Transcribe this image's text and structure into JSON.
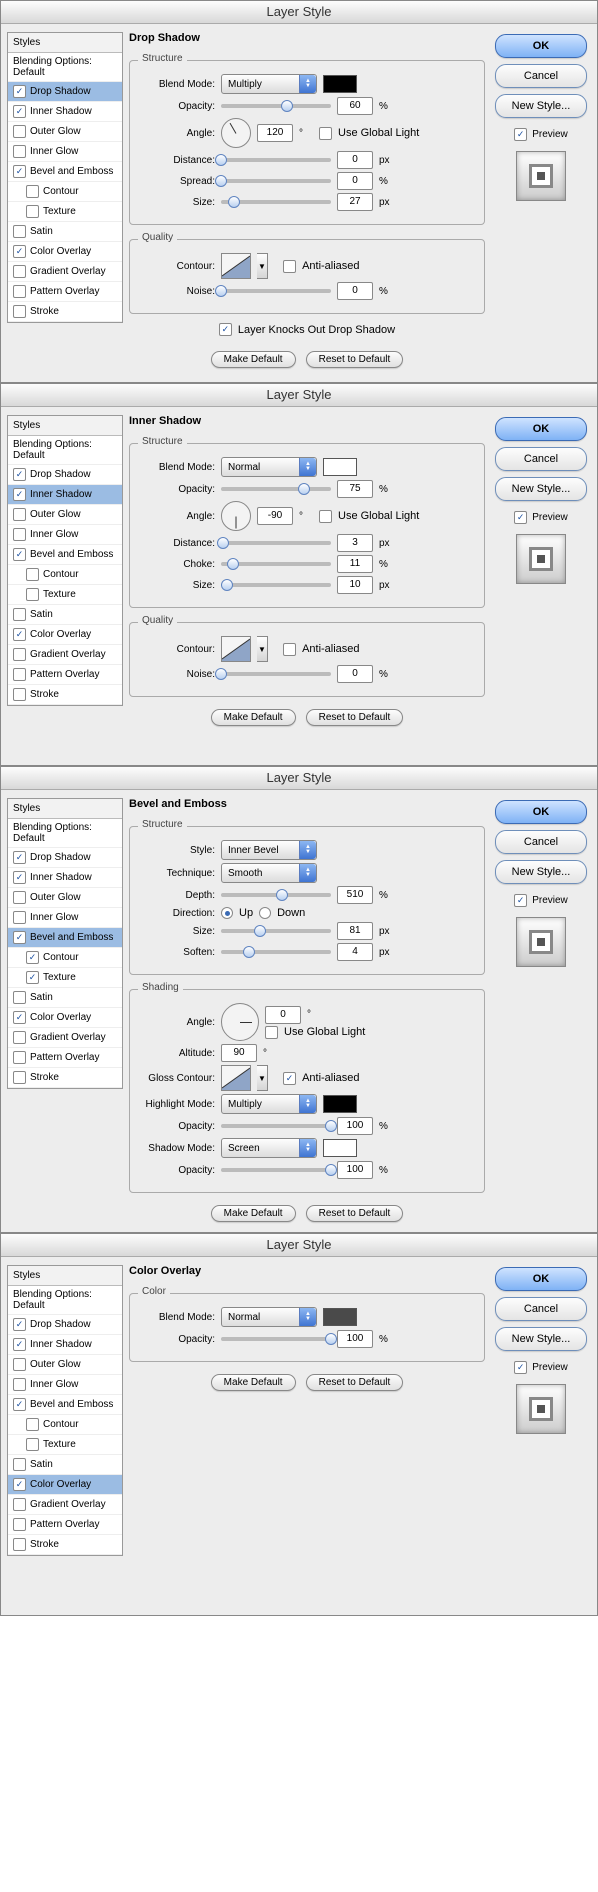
{
  "windowTitle": "Layer Style",
  "buttons": {
    "ok": "OK",
    "cancel": "Cancel",
    "newStyle": "New Style...",
    "preview": "Preview",
    "makeDefault": "Make Default",
    "resetDefault": "Reset to Default"
  },
  "sidebar": {
    "header": "Styles",
    "blendingDefault": "Blending Options: Default",
    "items": [
      {
        "label": "Drop Shadow",
        "indent": false
      },
      {
        "label": "Inner Shadow",
        "indent": false
      },
      {
        "label": "Outer Glow",
        "indent": false
      },
      {
        "label": "Inner Glow",
        "indent": false
      },
      {
        "label": "Bevel and Emboss",
        "indent": false
      },
      {
        "label": "Contour",
        "indent": true
      },
      {
        "label": "Texture",
        "indent": true
      },
      {
        "label": "Satin",
        "indent": false
      },
      {
        "label": "Color Overlay",
        "indent": false
      },
      {
        "label": "Gradient Overlay",
        "indent": false
      },
      {
        "label": "Pattern Overlay",
        "indent": false
      },
      {
        "label": "Stroke",
        "indent": false
      }
    ]
  },
  "labels": {
    "structure": "Structure",
    "quality": "Quality",
    "shading": "Shading",
    "color": "Color",
    "blendMode": "Blend Mode:",
    "opacity": "Opacity:",
    "angle": "Angle:",
    "useGlobal": "Use Global Light",
    "distance": "Distance:",
    "spread": "Spread:",
    "size": "Size:",
    "choke": "Choke:",
    "contour": "Contour:",
    "antialiased": "Anti-aliased",
    "noise": "Noise:",
    "knocksOut": "Layer Knocks Out Drop Shadow",
    "style": "Style:",
    "technique": "Technique:",
    "depth": "Depth:",
    "direction": "Direction:",
    "up": "Up",
    "down": "Down",
    "soften": "Soften:",
    "altitude": "Altitude:",
    "gloss": "Gloss Contour:",
    "highlight": "Highlight Mode:",
    "shadow": "Shadow Mode:",
    "px": "px",
    "pct": "%",
    "deg": "°"
  },
  "panels": [
    {
      "title": "Drop Shadow",
      "selected": "Drop Shadow",
      "checked": {
        "Drop Shadow": true,
        "Inner Shadow": true,
        "Bevel and Emboss": true,
        "Color Overlay": true
      },
      "fields": {
        "blendMode": "Multiply",
        "swatch": "#000000",
        "opacity": "60",
        "angle": "120",
        "useGlobal": false,
        "distance": "0",
        "spread": "0",
        "size": "27",
        "antialiased": false,
        "noise": "0",
        "knocksOut": true
      }
    },
    {
      "title": "Inner Shadow",
      "selected": "Inner Shadow",
      "checked": {
        "Drop Shadow": true,
        "Inner Shadow": true,
        "Bevel and Emboss": true,
        "Color Overlay": true
      },
      "fields": {
        "blendMode": "Normal",
        "swatch": "#ffffff",
        "opacity": "75",
        "angle": "-90",
        "useGlobal": false,
        "distance": "3",
        "choke": "11",
        "size": "10",
        "antialiased": false,
        "noise": "0"
      }
    },
    {
      "title": "Bevel and Emboss",
      "selected": "Bevel and Emboss",
      "checked": {
        "Drop Shadow": true,
        "Inner Shadow": true,
        "Bevel and Emboss": true,
        "Contour": true,
        "Texture": true,
        "Color Overlay": true
      },
      "fields": {
        "style": "Inner Bevel",
        "technique": "Smooth",
        "depth": "510",
        "dirUp": true,
        "size": "81",
        "soften": "4",
        "angle": "0",
        "useGlobal": false,
        "altitude": "90",
        "antialiased": true,
        "highlightMode": "Multiply",
        "highlightSwatch": "#000000",
        "highlightOpacity": "100",
        "shadowMode": "Screen",
        "shadowSwatch": "#ffffff",
        "shadowOpacity": "100"
      }
    },
    {
      "title": "Color Overlay",
      "selected": "Color Overlay",
      "checked": {
        "Drop Shadow": true,
        "Inner Shadow": true,
        "Bevel and Emboss": true,
        "Color Overlay": true
      },
      "fields": {
        "blendMode": "Normal",
        "swatch": "#4a4a4a",
        "opacity": "100"
      }
    }
  ]
}
